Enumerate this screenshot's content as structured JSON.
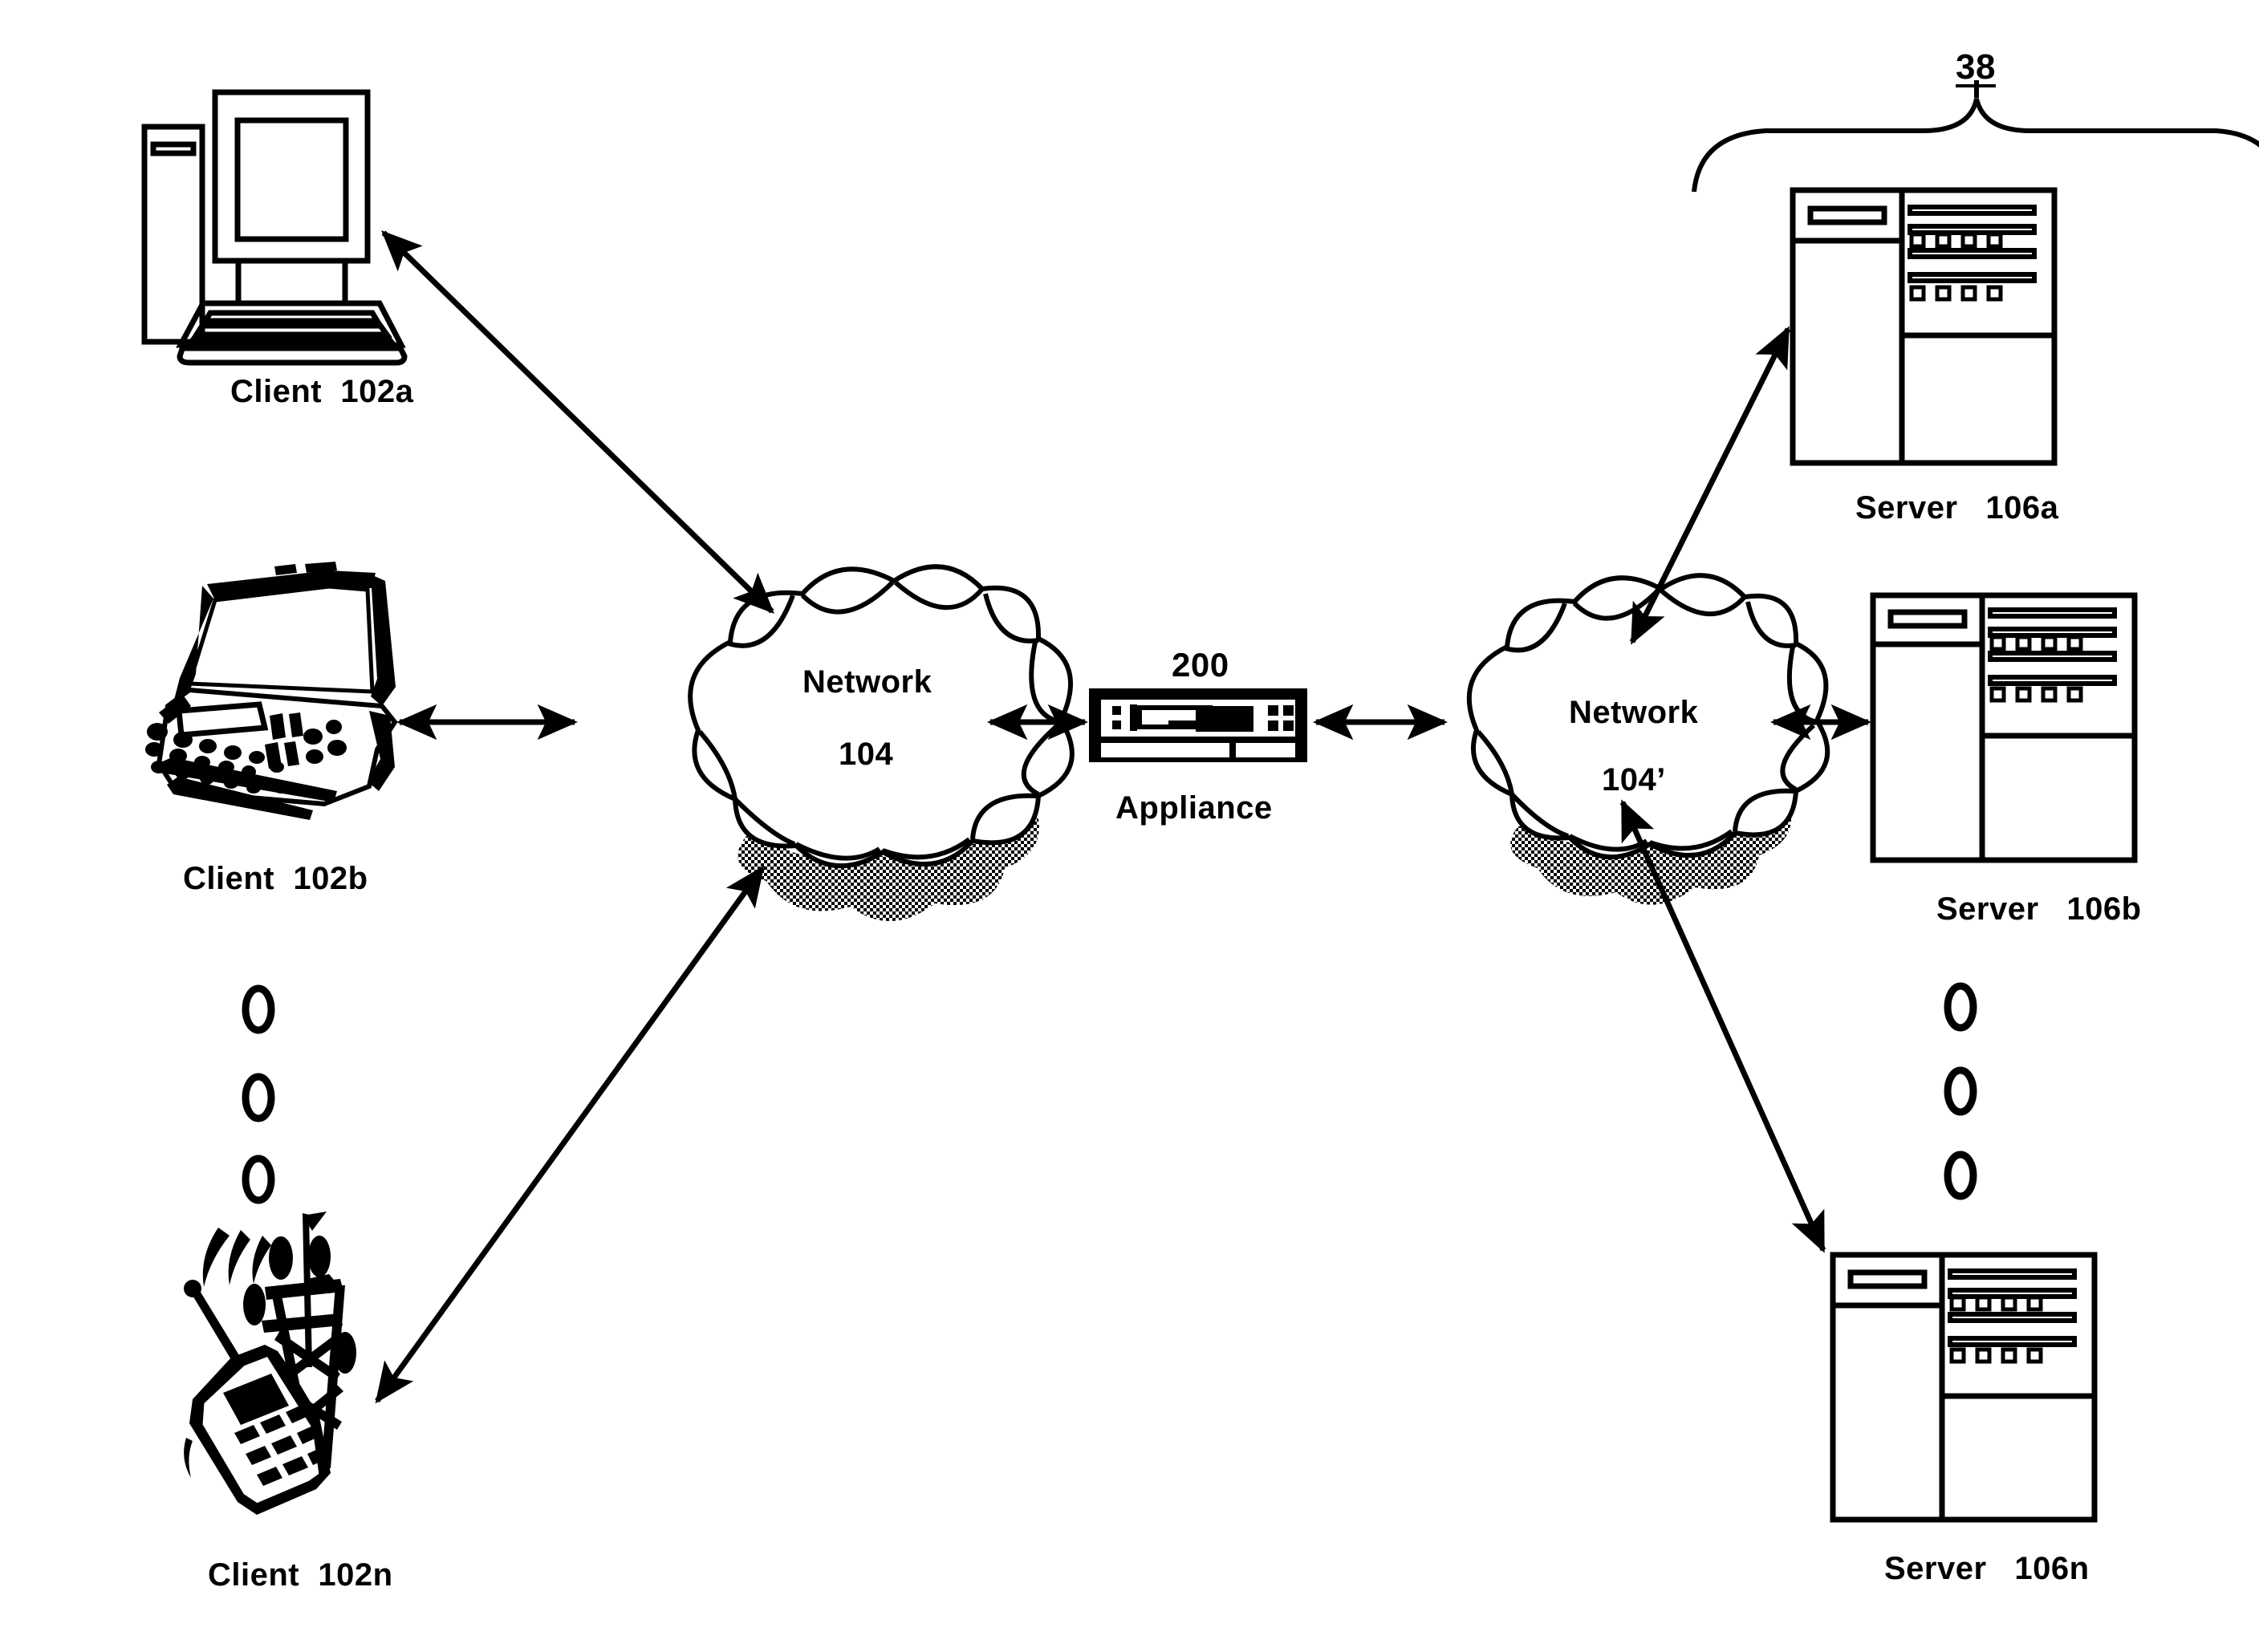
{
  "figure": {
    "reference_number": "38",
    "clients": [
      {
        "id": "client-102a",
        "name": "Client",
        "ref": "102a",
        "device": "desktop-computer-icon",
        "label": "Client  102a"
      },
      {
        "id": "client-102b",
        "name": "Client",
        "ref": "102b",
        "device": "laptop-computer-icon",
        "label": "Client  102b"
      },
      {
        "id": "client-102n",
        "name": "Client",
        "ref": "102n",
        "device": "mobile-phone-tower-icon",
        "label": "Client  102n"
      }
    ],
    "clouds": [
      {
        "id": "network-104",
        "name": "Network",
        "ref": "104"
      },
      {
        "id": "network-104-prime",
        "name": "Network",
        "ref": "104’"
      }
    ],
    "appliance": {
      "id": "appliance-200",
      "name": "Appliance",
      "ref": "200"
    },
    "servers": [
      {
        "id": "server-106a",
        "name": "Server",
        "ref": "106a",
        "label": "Server   106a"
      },
      {
        "id": "server-106b",
        "name": "Server",
        "ref": "106b",
        "label": "Server   106b"
      },
      {
        "id": "server-106n",
        "name": "Server",
        "ref": "106n",
        "label": "Server   106n"
      }
    ],
    "ellipsis": {
      "glyph": "◯",
      "count": 3
    },
    "colors": {
      "stroke": "#000000",
      "fill": "#ffffff",
      "shadow": "#7a7a7a"
    }
  }
}
